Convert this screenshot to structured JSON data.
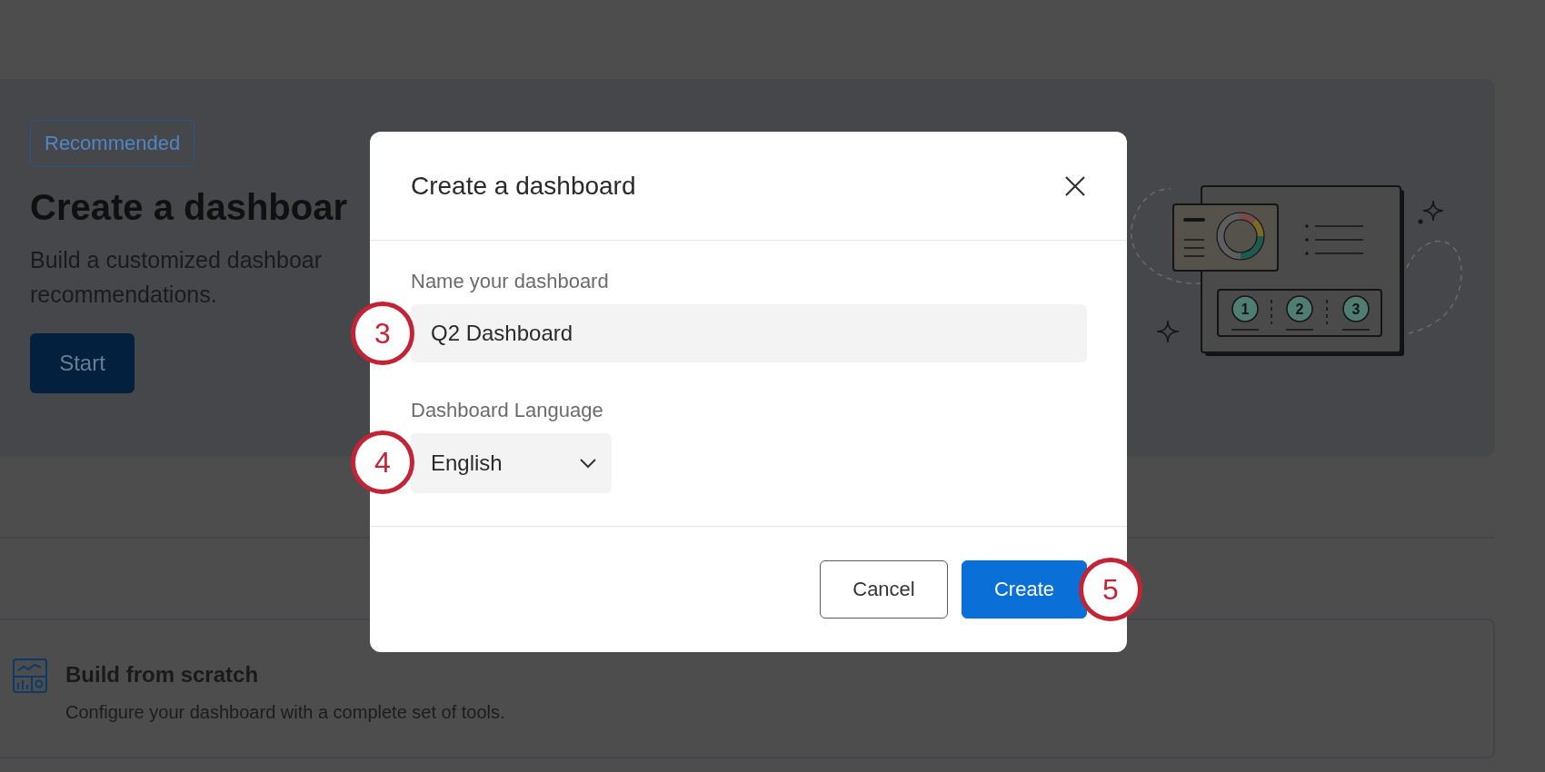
{
  "page": {
    "banner": {
      "tag": "Recommended",
      "title": "Create a dashboar",
      "description": [
        "Build a customized dashboar",
        "recommendations."
      ],
      "button": "Start",
      "illustration_steps": [
        "1",
        "2",
        "3"
      ]
    },
    "option": {
      "title": "Build from scratch",
      "description": "Configure your dashboard with a complete set of tools."
    }
  },
  "dialog": {
    "title": "Create a dashboard",
    "fields": [
      {
        "kind": "text",
        "label": "Name your dashboard",
        "value": "Q2 Dashboard"
      },
      {
        "kind": "select",
        "label": "Dashboard Language",
        "value": "English"
      }
    ],
    "buttons": [
      {
        "kind": "secondary",
        "label": "Cancel"
      },
      {
        "kind": "primary",
        "label": "Create"
      }
    ]
  },
  "callouts": [
    "3",
    "4",
    "5"
  ]
}
